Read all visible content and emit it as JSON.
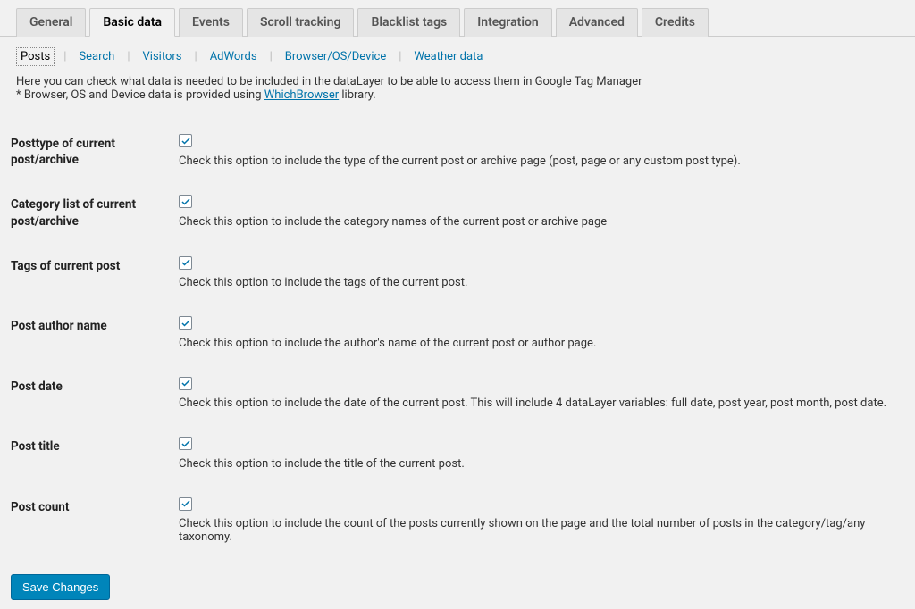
{
  "tabs": {
    "items": [
      {
        "label": "General"
      },
      {
        "label": "Basic data"
      },
      {
        "label": "Events"
      },
      {
        "label": "Scroll tracking"
      },
      {
        "label": "Blacklist tags"
      },
      {
        "label": "Integration"
      },
      {
        "label": "Advanced"
      },
      {
        "label": "Credits"
      }
    ],
    "active_index": 1
  },
  "subtabs": {
    "items": [
      {
        "label": "Posts"
      },
      {
        "label": "Search"
      },
      {
        "label": "Visitors"
      },
      {
        "label": "AdWords"
      },
      {
        "label": "Browser/OS/Device"
      },
      {
        "label": "Weather data"
      }
    ],
    "active_index": 0
  },
  "intro": {
    "line1": "Here you can check what data is needed to be included in the dataLayer to be able to access them in Google Tag Manager",
    "line2_prefix": "* Browser, OS and Device data is provided using ",
    "line2_link": "WhichBrowser",
    "line2_suffix": " library."
  },
  "options": [
    {
      "title": "Posttype of current post/archive",
      "desc": "Check this option to include the type of the current post or archive page (post, page or any custom post type).",
      "checked": true
    },
    {
      "title": "Category list of current post/archive",
      "desc": "Check this option to include the category names of the current post or archive page",
      "checked": true
    },
    {
      "title": "Tags of current post",
      "desc": "Check this option to include the tags of the current post.",
      "checked": true
    },
    {
      "title": "Post author name",
      "desc": "Check this option to include the author's name of the current post or author page.",
      "checked": true
    },
    {
      "title": "Post date",
      "desc": "Check this option to include the date of the current post. This will include 4 dataLayer variables: full date, post year, post month, post date.",
      "checked": true
    },
    {
      "title": "Post title",
      "desc": "Check this option to include the title of the current post.",
      "checked": true
    },
    {
      "title": "Post count",
      "desc": "Check this option to include the count of the posts currently shown on the page and the total number of posts in the category/tag/any taxonomy.",
      "checked": true
    }
  ],
  "buttons": {
    "save": "Save Changes"
  },
  "colors": {
    "link": "#0073aa",
    "primary_bg": "#0085ba"
  }
}
